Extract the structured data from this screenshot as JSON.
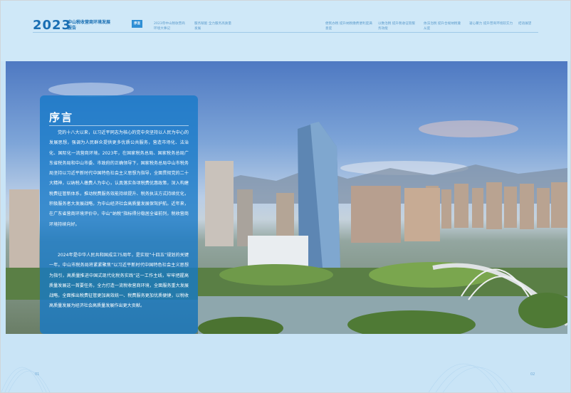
{
  "header": {
    "year": "2023",
    "report_title": "中山税收营商环境发展报告",
    "nav": [
      {
        "label": "序言",
        "active": true
      },
      {
        "label": "2023年中山税收营商环境大事记",
        "active": false
      },
      {
        "label": "服务赋能 全力服务高质量发展",
        "active": false
      },
      {
        "label": "便民办税 提升纳税缴费便利度满意度",
        "active": false
      },
      {
        "label": "以数治税 提升税收征管服务效能",
        "active": false
      },
      {
        "label": "依法治税 提升合规纳税遵从度",
        "active": false
      },
      {
        "label": "凝心聚力 提升营商环境软实力",
        "active": false
      },
      {
        "label": "结语展望",
        "active": false
      }
    ]
  },
  "intro": {
    "title": "序言",
    "paragraphs": [
      "党的十八大以来，以习近平同志为核心的党中央坚持以人民为中心的发展思想，强调为人民群众提供更多优质公共服务，营造市场化、法治化、国际化一流营商环境。2023年，在国家税务总局、国家税务总局广东省税务局和中山市委、市政府的正确领导下，国家税务总局中山市税务局坚持以习近平新时代中国特色社会主义思想为指导，全面贯彻党的二十大精神，以纳税人缴费人为中心，认真落实各项税费优惠政策，深入构建税费征管新体系，推动税费服务效能持续提升、税务执法方式持续优化，积极服务者大发展战略，为中山经济社会高质量发展保驾护航。近年来，在广东省营商环境评价中，中山“纳税”指标得分稳居全省前列，税收营商环境持续向好。",
      "2024年是中华人民共和国成立75周年，是实现“十四五”规划的关键一年。中山市税务局将紧紧聚焦“以习近平新时代中国特色社会主义思想为指引，高质量推进中国式现代化税务实践”这一工作主线，牢牢把握高质量发展这一首要任务，全力打造一流税收营商环境，全面服务重大发展战略，全面推出税费征管更加高效统一、税费服务更加优质便捷，以税收高质量发展为经济社会高质量发展作出更大贡献。"
    ]
  },
  "footer": {
    "page_left": "01",
    "page_right": "02"
  },
  "colors": {
    "accent": "#1a6fb3",
    "panel": "#1478c8",
    "background": "#c9e4f6"
  }
}
